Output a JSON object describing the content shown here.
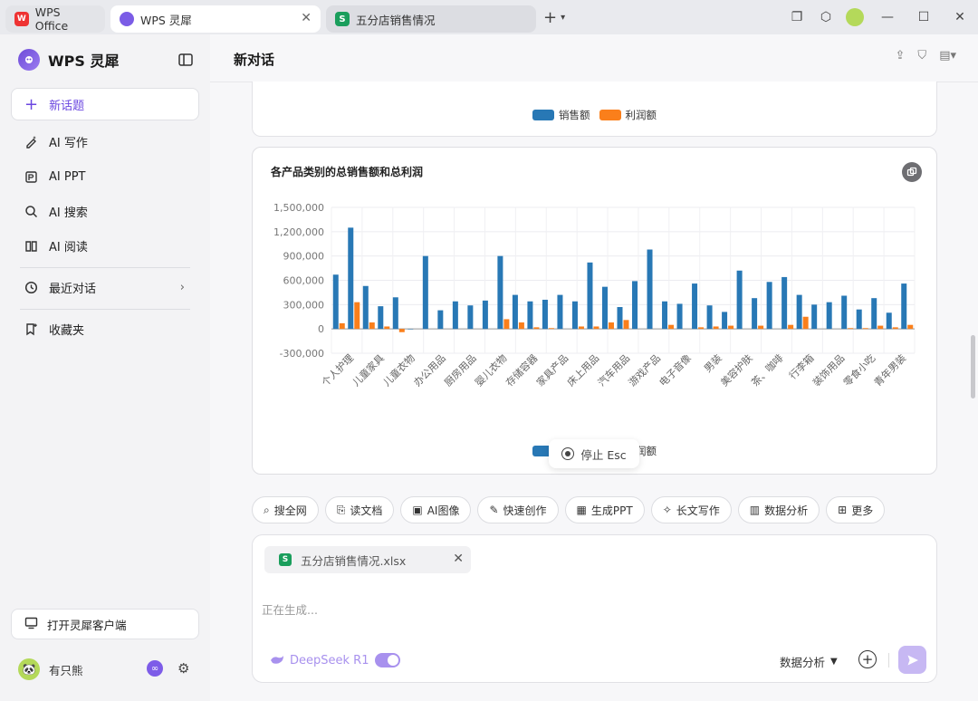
{
  "titlebar": {
    "tabs": [
      {
        "label": "WPS Office"
      },
      {
        "label": "WPS 灵犀"
      },
      {
        "label": "五分店销售情况"
      }
    ]
  },
  "sidebar": {
    "brand": "WPS 灵犀",
    "new_topic": "新话题",
    "items": [
      {
        "label": "AI 写作"
      },
      {
        "label": "AI PPT"
      },
      {
        "label": "AI 搜索"
      },
      {
        "label": "AI 阅读"
      },
      {
        "label": "最近对话"
      },
      {
        "label": "收藏夹"
      }
    ],
    "open_client": "打开灵犀客户端",
    "username": "有只熊"
  },
  "main": {
    "title": "新对话",
    "stop_label": "停止 Esc",
    "tools": [
      "搜全网",
      "读文档",
      "AI图像",
      "快速创作",
      "生成PPT",
      "长文写作",
      "数据分析",
      "更多"
    ],
    "composer": {
      "file_name": "五分店销售情况.xlsx",
      "status": "正在生成...",
      "model": "DeepSeek R1",
      "mode": "数据分析"
    }
  },
  "colors": {
    "sales": "#2878b5",
    "profit": "#fa7f1b",
    "accent": "#6b47e0"
  },
  "chart_data": {
    "type": "bar",
    "title": "各产品类别的总销售额和总利润",
    "legend": [
      "销售额",
      "利润额"
    ],
    "ylim": [
      -300000,
      1500000
    ],
    "yticks": [
      "1,500,000",
      "1,200,000",
      "900,000",
      "600,000",
      "300,000",
      "0",
      "-300,000"
    ],
    "xtick_labels": [
      "个人护理",
      "儿童家具",
      "儿童衣物",
      "办公用品",
      "厨房用品",
      "婴儿衣物",
      "存储容器",
      "家具产品",
      "床上用品",
      "汽车用品",
      "游戏产品",
      "电子音像",
      "男装",
      "美容护肤",
      "茶、咖啡",
      "行李箱",
      "装饰用品",
      "零食小吃",
      "青年男装"
    ],
    "series": [
      {
        "name": "销售额",
        "values": [
          670000,
          1250000,
          530000,
          280000,
          390000,
          -5000,
          900000,
          230000,
          340000,
          290000,
          350000,
          900000,
          420000,
          340000,
          360000,
          420000,
          340000,
          820000,
          520000,
          270000,
          590000,
          980000,
          340000,
          310000,
          560000,
          290000,
          210000,
          720000,
          380000,
          580000,
          640000,
          420000,
          300000,
          330000,
          410000,
          240000,
          380000,
          200000,
          560000
        ]
      },
      {
        "name": "利润额",
        "values": [
          70000,
          330000,
          80000,
          30000,
          -40000,
          0,
          0,
          0,
          0,
          0,
          0,
          120000,
          80000,
          20000,
          10000,
          0,
          30000,
          30000,
          80000,
          110000,
          0,
          0,
          50000,
          0,
          20000,
          30000,
          40000,
          0,
          40000,
          0,
          50000,
          150000,
          0,
          0,
          10000,
          10000,
          40000,
          20000,
          50000
        ]
      }
    ]
  }
}
